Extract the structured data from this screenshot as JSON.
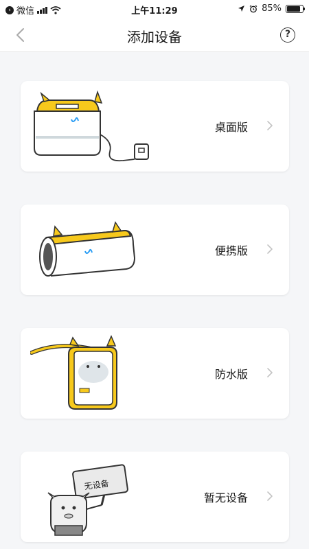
{
  "status_bar": {
    "app": "微信",
    "time": "上午11:29",
    "battery": "85%",
    "battery_level": 0.85
  },
  "nav": {
    "title": "添加设备",
    "help": "?"
  },
  "devices": [
    {
      "label": "桌面版"
    },
    {
      "label": "便携版"
    },
    {
      "label": "防水版"
    },
    {
      "label": "暂无设备",
      "sign_text": "无设备"
    }
  ],
  "colors": {
    "accent_yellow": "#f7c91c",
    "background": "#f5f6f8",
    "card": "#ffffff"
  }
}
